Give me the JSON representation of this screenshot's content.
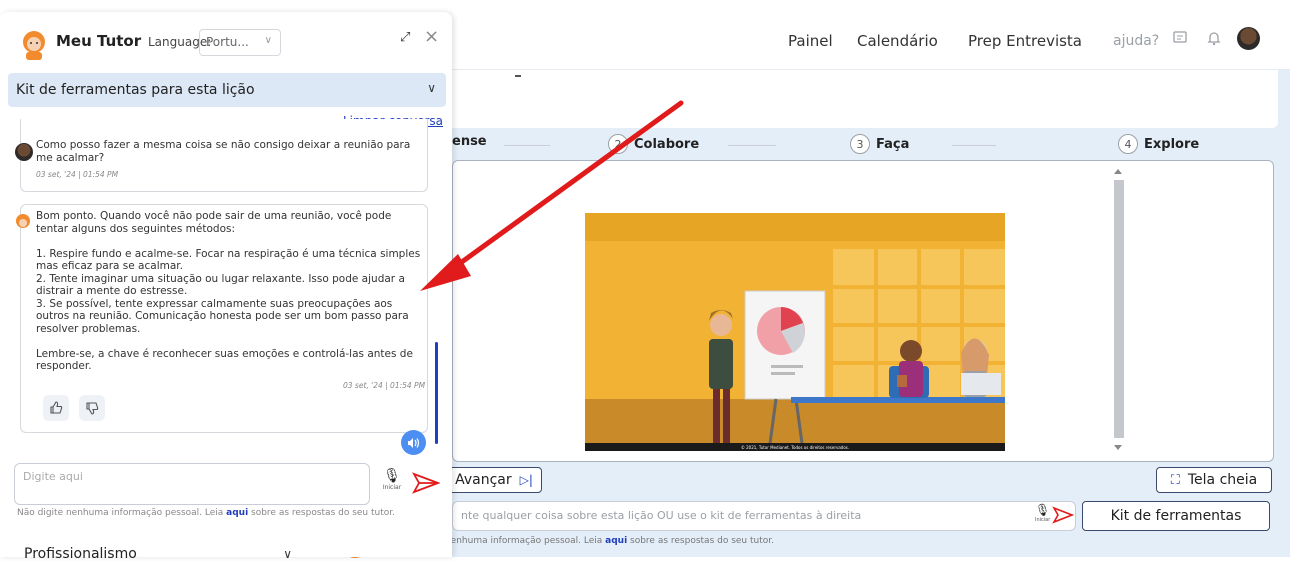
{
  "nav": {
    "links": [
      "Painel",
      "Calendário",
      "Prep Entrevista"
    ],
    "help": "ajuda?"
  },
  "lesson": {
    "steps": [
      {
        "num": "",
        "label": "ense"
      },
      {
        "num": "2",
        "label": "Colabore"
      },
      {
        "num": "3",
        "label": "Faça"
      },
      {
        "num": "4",
        "label": "Explore"
      }
    ],
    "video_credit": "© 2021, Tutor Medianet. Todos os direitos reservados.",
    "next_button": "Avançar",
    "fullscreen_button": "Tela cheia",
    "input_placeholder": "nte qualquer coisa sobre esta lição OU use o kit de ferramentas à direita",
    "mic_label": "Iniciar",
    "toolkit_button": "Kit de ferramentas",
    "disclaimer_pre": "Não digite nenhuma informação pessoal. Leia ",
    "disclaimer_link": "aqui",
    "disclaimer_post": " sobre as respostas do seu tutor."
  },
  "chat": {
    "title": "Meu Tutor",
    "language_label": "Language:",
    "language_value": "Portu...",
    "toolkit_title": "Kit de ferramentas para esta lição",
    "clear_link": "Limpar conversa",
    "messages": [
      {
        "role": "user",
        "text": "Como posso fazer a mesma coisa se não consigo deixar a reunião para\nme acalmar?",
        "time": "03 set, '24 | 01:54 PM"
      },
      {
        "role": "bot",
        "text": "Bom ponto. Quando você não pode sair de uma reunião, você pode\ntentar alguns dos seguintes métodos:\n\n1. Respire fundo e acalme-se. Focar na respiração é uma técnica simples\nmas eficaz para se acalmar.\n2. Tente imaginar uma situação ou lugar relaxante. Isso pode ajudar a\ndistrair a mente do estresse.\n3. Se possível, tente expressar calmamente suas preocupações aos\noutros na reunião. Comunicação honesta pode ser um bom passo para\nresolver problemas.\n\nLembre-se, a chave é reconhecer suas emoções e controlá-las antes de\nresponder.",
        "time": "03 set, '24 | 01:54 PM"
      }
    ],
    "input_placeholder": "Digite aqui",
    "mic_label": "Iniciar",
    "disclaimer_pre": "Não digite nenhuma informação pessoal. Leia ",
    "disclaimer_link": "aqui",
    "disclaimer_post": " sobre as respostas do seu tutor.",
    "section_title": "Profissionalismo"
  },
  "colors": {
    "accent_blue": "#1f3fbf",
    "speaker_blue": "#4d8ef2",
    "arrow_red": "#e11b1b",
    "toolkit_bg": "#dde8f6",
    "video_yellow": "#f2b233"
  }
}
